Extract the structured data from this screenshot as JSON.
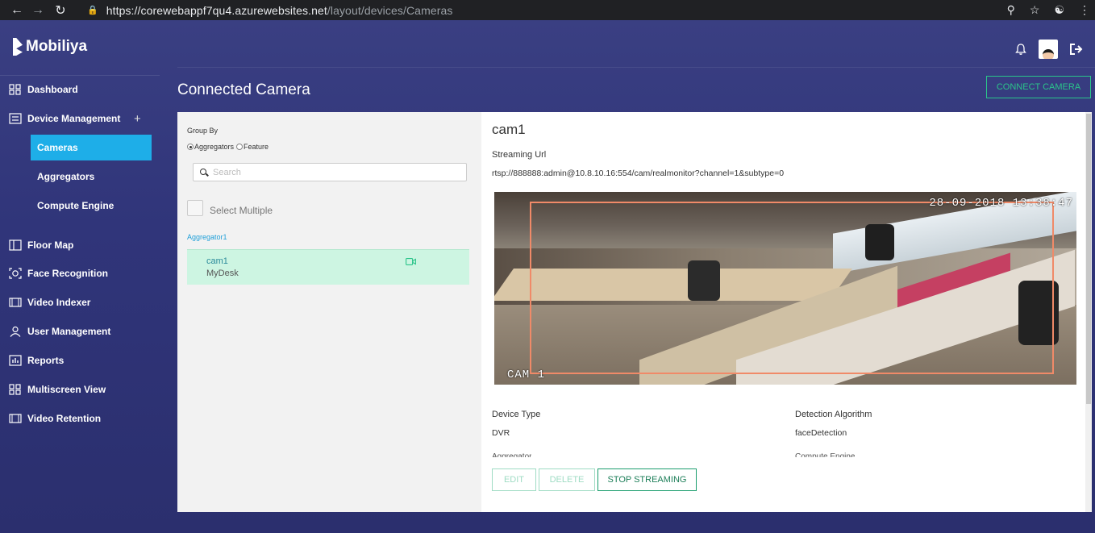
{
  "browser": {
    "url_host": "https://corewebappf7qu4.azurewebsites.net",
    "url_path": "/layout/devices/Cameras"
  },
  "brand": {
    "name": "Mobiliya"
  },
  "sidebar": {
    "items": [
      {
        "label": "Dashboard"
      },
      {
        "label": "Device Management",
        "expand": "+"
      },
      {
        "label": "Cameras"
      },
      {
        "label": "Aggregators"
      },
      {
        "label": "Compute Engine"
      },
      {
        "label": "Floor Map"
      },
      {
        "label": "Face Recognition"
      },
      {
        "label": "Video Indexer"
      },
      {
        "label": "User Management"
      },
      {
        "label": "Reports"
      },
      {
        "label": "Multiscreen View"
      },
      {
        "label": "Video Retention"
      }
    ]
  },
  "page": {
    "title": "Connected Camera",
    "connect_button": "CONNECT CAMERA"
  },
  "list_panel": {
    "group_by_label": "Group By",
    "radio_aggregators": "Aggregators",
    "radio_feature": "Feature",
    "search_placeholder": "Search",
    "select_multiple": "Select Multiple",
    "group_name": "Aggregator1",
    "cameras": [
      {
        "name": "cam1",
        "location": "MyDesk"
      }
    ]
  },
  "detail": {
    "camera_name": "cam1",
    "streaming_url_label": "Streaming Url",
    "streaming_url": "rtsp://888888:admin@10.8.10.16:554/cam/realmonitor?channel=1&subtype=0",
    "overlay_timestamp": "28-09-2018 13:38:47",
    "overlay_camera": "CAM 1",
    "device_type_label": "Device Type",
    "device_type": "DVR",
    "detection_algorithm_label": "Detection Algorithm",
    "detection_algorithm": "faceDetection",
    "aggregator_label": "Aggregator",
    "compute_engine_label": "Compute Engine",
    "buttons": {
      "edit": "EDIT",
      "delete": "DELETE",
      "stop_streaming": "STOP STREAMING"
    }
  },
  "colors": {
    "accent_blue": "#1eaee8",
    "accent_green": "#2bc48a",
    "selected_row": "#cdf5e2",
    "bbox": "#f08a68"
  }
}
